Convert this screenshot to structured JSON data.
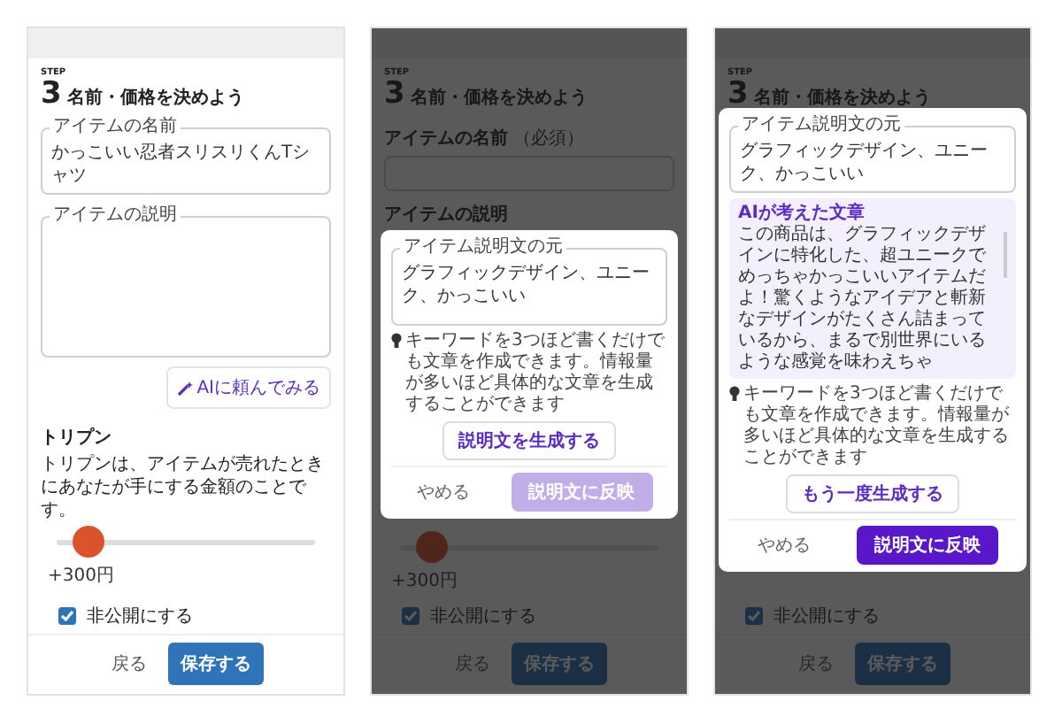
{
  "panels": [
    {
      "step_label": "STEP",
      "step_number": "3",
      "title": "名前・価格を決めよう",
      "name_field": {
        "label": "アイテムの名前",
        "value": "かっこいい忍者スリスリくんTシャツ"
      },
      "description_field": {
        "label": "アイテムの説明"
      },
      "ai_button": "AIに頼んでみる",
      "price": {
        "label": "トリプン",
        "description": "トリプンは、アイテムが売れたときにあなたが手にする金額のことです。",
        "level": 0.12,
        "reading": "+300円"
      },
      "private_checkbox": {
        "label": "非公開にする",
        "checked": true
      },
      "back_button": "戻る",
      "save_button": "保存する"
    },
    {
      "step_label": "STEP",
      "step_number": "3",
      "title": "名前・価格を決めよう",
      "name_field": {
        "label": "アイテムの名前",
        "note": "（必須）"
      },
      "description_label": "アイテムの説明",
      "price": {
        "level": 0.12,
        "reading": "+300円"
      },
      "private_checkbox": {
        "label": "非公開にする",
        "checked": true
      },
      "back_button": "戻る",
      "save_button": "保存する",
      "modal": {
        "source_field": {
          "label": "アイテム説明文の元",
          "value": "グラフィックデザイン、ユニーク、かっこいい"
        },
        "hint": "キーワードを3つほど書くだけでも文章を作成できます。情報量が多いほど具体的な文章を生成することができます",
        "generate_button": "説明文を生成する",
        "cancel_button": "やめる",
        "reflect_button": {
          "label": "説明文に反映",
          "disabled": true
        }
      }
    },
    {
      "step_label": "STEP",
      "step_number": "3",
      "title": "名前・価格を決めよう",
      "private_checkbox": {
        "label": "非公開にする",
        "checked": true
      },
      "back_button": "戻る",
      "save_button": "保存する",
      "modal": {
        "source_field": {
          "label": "アイテム説明文の元",
          "value": "グラフィックデザイン、ユニーク、かっこいい"
        },
        "ai_result": {
          "title": "AIが考えた文章",
          "text": "この商品は、グラフィックデザインに特化した、超ユニークでめっちゃかっこいいアイテムだよ！驚くようなアイデアと斬新なデザインがたくさん詰まっているから、まるで別世界にいるような感覚を味わえちゃ"
        },
        "hint": "キーワードを3つほど書くだけでも文章を作成できます。情報量が多いほど具体的な文章を生成することができます",
        "generate_button": "もう一度生成する",
        "cancel_button": "やめる",
        "reflect_button": {
          "label": "説明文に反映",
          "disabled": false
        }
      }
    }
  ]
}
